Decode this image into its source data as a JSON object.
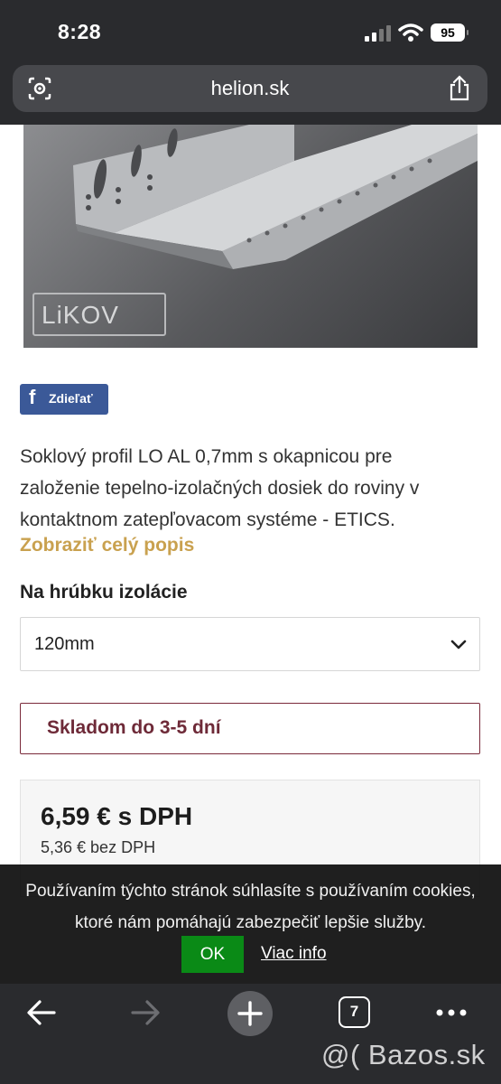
{
  "status_bar": {
    "time": "8:28",
    "battery": "95"
  },
  "browser": {
    "url": "helion.sk"
  },
  "product": {
    "brand_logo_text": "LiKOV",
    "share_label": "Zdieľať",
    "share_icon_glyph": "f",
    "description": "Soklový profil LO AL 0,7mm s okapnicou pre založenie tepelno-izolačných dosiek do roviny v kontaktnom zatepľovacom systéme - ETICS.",
    "show_more_label": "Zobraziť celý popis",
    "option_label": "Na hrúbku izolácie",
    "option_selected": "120mm",
    "stock_status": "Skladom do 3-5 dní",
    "price_with_vat": "6,59 € s DPH",
    "price_without_vat": "5,36 € bez DPH"
  },
  "cookie_banner": {
    "text": "Používaním týchto stránok súhlasíte s používaním cookies, ktoré nám pomáhajú zabezpečiť lepšie služby.",
    "ok_label": "OK",
    "more_info_label": "Viac info"
  },
  "toolbar": {
    "tab_count": "7"
  },
  "watermark": "@( Bazos.sk",
  "colors": {
    "chrome": "#2a2b2e",
    "accent_gold": "#c9a14f",
    "stock_border": "#7a2a3a",
    "facebook": "#3b5998",
    "ok_green": "#0a8a16"
  }
}
